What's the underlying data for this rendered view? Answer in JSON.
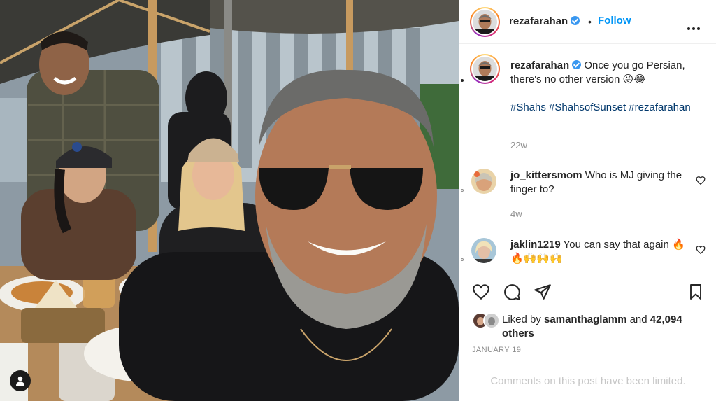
{
  "post": {
    "author": "rezafarahan",
    "follow_label": "Follow",
    "separator": "•",
    "caption": {
      "username": "rezafarahan",
      "text": "Once you go Persian, there's no other version 😜😂",
      "hashtags": "#Shahs #ShahsofSunset #rezafarahan",
      "age": "22w"
    },
    "comments": [
      {
        "username": "jo_kittersmom",
        "text": "Who is MJ giving the finger to?",
        "age": "4w"
      },
      {
        "username": "jaklin1219",
        "text": "You can say that again 🔥🔥🙌🙌🙌"
      }
    ],
    "likes": {
      "prefix": "Liked by",
      "user": "samanthaglamm",
      "joiner": "and",
      "others": "42,094 others"
    },
    "date": "JANUARY 19",
    "comments_limited": "Comments on this post have been limited."
  },
  "icons": {
    "header_more": "more-horizontal-icon",
    "like": "heart-icon",
    "comment": "comment-icon",
    "share": "send-icon",
    "save": "bookmark-icon",
    "user_tags": "person-icon",
    "verified": "verified-badge-icon"
  },
  "colors": {
    "accent": "#0095f6",
    "verified": "#3897f0",
    "hashtag": "#00376b",
    "muted": "#8e8e8e"
  }
}
